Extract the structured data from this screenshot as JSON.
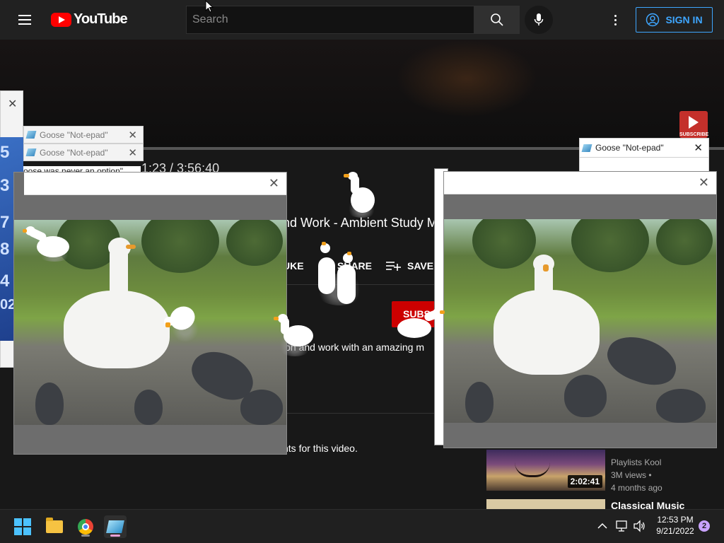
{
  "youtube": {
    "logo_text": "YouTube",
    "search_placeholder": "Search",
    "sign_in_label": "SIGN IN",
    "time_display": "1:23 / 3:56:40",
    "subscribe_watermark": "SUBSCRIBE",
    "video_title": "nd Work - Ambient Study M",
    "actions": {
      "like": "UKE",
      "share": "SHARE",
      "save": "SAVE"
    },
    "subscribe_label": "SUBS",
    "description": "ion and work with an amazing m",
    "comments_text": "nts for this video."
  },
  "sidebar": {
    "rec1": {
      "duration": "2:02:41",
      "channel": "Playlists Kool",
      "views": "3M views •",
      "age": "4 months ago"
    },
    "rec2": {
      "title": "Classical Music"
    }
  },
  "notepad": {
    "tab1_title": "Goose \"Not-epad\"",
    "tab2_title": "Goose \"Not-epad\"",
    "tab3_title": "Goose \"Not-epad\"",
    "note_text": "oose was never an option\"",
    "close_glyph": "✕"
  },
  "calendar_strip": {
    "numbers": [
      "5",
      "3",
      "7",
      "8",
      "4",
      "02"
    ]
  },
  "taskbar": {
    "time": "12:53 PM",
    "date": "9/21/2022",
    "notification_count": "2"
  },
  "colors": {
    "yt_red": "#ff0000",
    "link_blue": "#3ea6ff",
    "background": "#181818",
    "taskbar": "#202020"
  }
}
